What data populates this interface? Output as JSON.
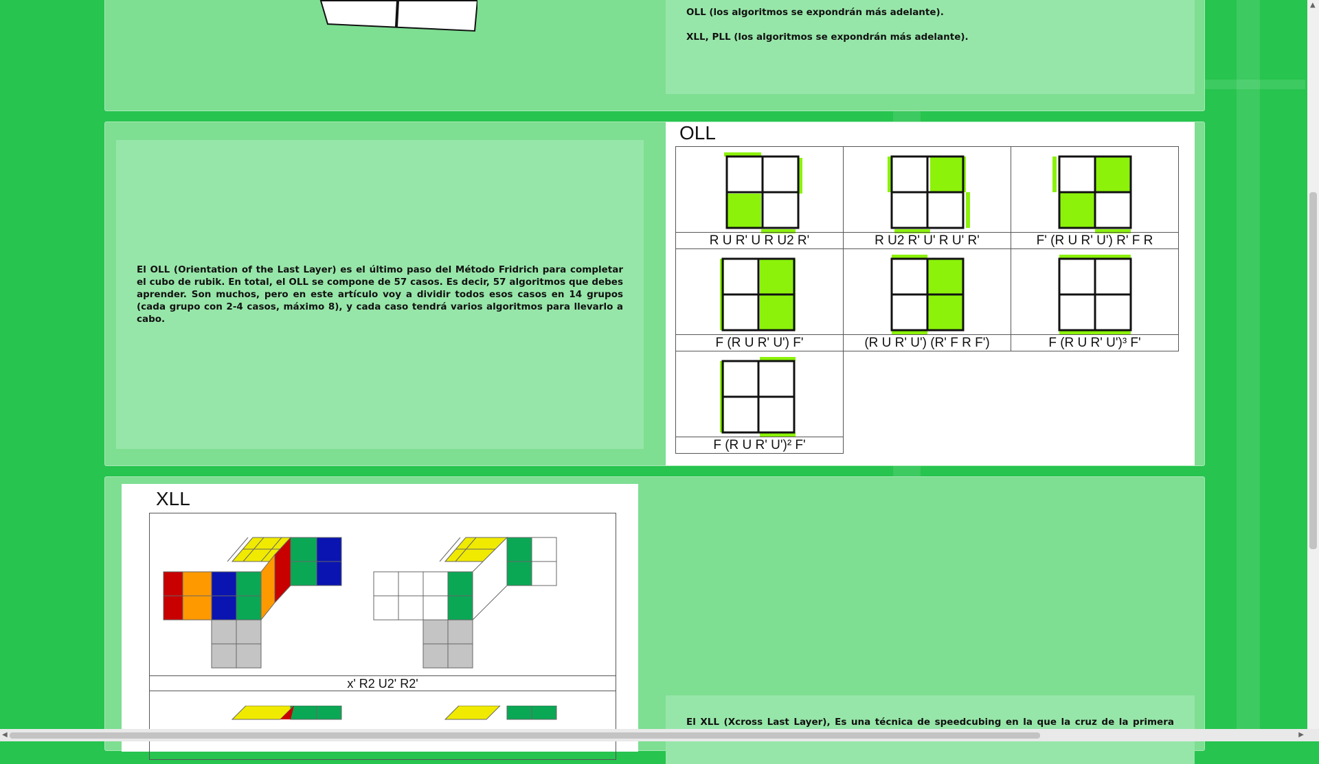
{
  "top_section": {
    "line1": "OLL (los algoritmos se expondrán más adelante).",
    "line2": "XLL, PLL (los algoritmos se expondrán más adelante)."
  },
  "oll_section": {
    "paragraph": "El OLL (Orientation of the Last Layer) es el último paso del Método Fridrich para completar el cubo de rubik. En total, el OLL se compone de 57 casos. Es decir, 57 algoritmos que debes aprender. Son muchos, pero en este artículo voy a dividir todos esos casos en 14 grupos (cada grupo con 2-4 casos, máximo 8), y cada caso tendrá varios algoritmos para llevarlo a cabo.",
    "image_title": "OLL",
    "cases": [
      {
        "label": "R U R' U R U2 R'",
        "icon": "oll-case-1-icon"
      },
      {
        "label": "R U2 R' U' R U' R'",
        "icon": "oll-case-2-icon"
      },
      {
        "label": "F' (R U R' U') R' F R",
        "icon": "oll-case-3-icon"
      },
      {
        "label": "F (R U R' U') F'",
        "icon": "oll-case-4-icon"
      },
      {
        "label": "(R U R' U') (R' F R F')",
        "icon": "oll-case-5-icon"
      },
      {
        "label": "F (R U R' U')³ F'",
        "icon": "oll-case-6-icon"
      },
      {
        "label": "F (R U R' U')² F'",
        "icon": "oll-case-7-icon"
      }
    ]
  },
  "xll_section": {
    "image_title": "XLL",
    "caption": "x' R2 U2' R2'",
    "paragraph": "El XLL (Xcross Last Layer), Es una técnica de speedcubing en la que la cruz de la primera capa se"
  },
  "colors": {
    "background": "#27c44f",
    "panel": "#7ede92",
    "text_card": "#97e6a9",
    "sticker_green": "#8cf20a"
  }
}
